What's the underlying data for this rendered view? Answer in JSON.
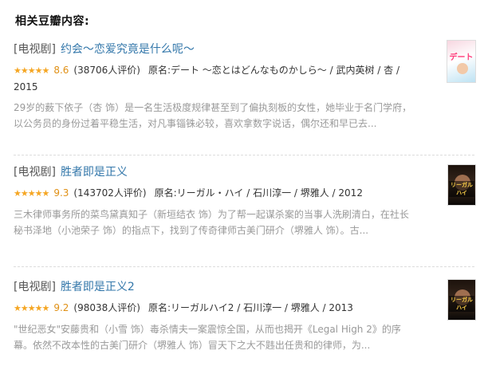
{
  "header": {
    "title": "相关豆瓣内容:"
  },
  "items": [
    {
      "category": "[电视剧]",
      "title": "约会～恋爱究竟是什么呢～",
      "stars": "★★★★★",
      "rating": "8.6",
      "rating_value": 8.6,
      "count": "(38706人评价)",
      "info": "原名:デート 〜恋とはどんなものかしら〜 / 武内英树 / 杏 / 2015",
      "desc": "29岁的薮下依子（杏 饰）是一名生活极度规律甚至到了偏执刻板的女性，她毕业于名门学府，以公务员的身份过着平稳生活，对凡事锱铢必较，喜欢拿数字说话，偶尔还和早已去...",
      "poster": {
        "logo": "デート"
      }
    },
    {
      "category": "[电视剧]",
      "title": "胜者即是正义",
      "stars": "★★★★★",
      "rating": "9.3",
      "rating_value": 9.3,
      "count": "(143702人评价)",
      "info": "原名:リーガル・ハイ / 石川淳一 / 堺雅人 / 2012",
      "desc": "三木律师事务所的菜鸟黛真知子（新垣结衣 饰）为了帮一起谋杀案的当事人洗刷清白，在社长秘书泽地（小池荣子 饰）的指点下，找到了传奇律师古美门研介（堺雅人 饰）。古...",
      "poster": {
        "logo": "リーガルハイ"
      }
    },
    {
      "category": "[电视剧]",
      "title": "胜者即是正义2",
      "stars": "★★★★★",
      "rating": "9.2",
      "rating_value": 9.2,
      "count": "(98038人评价)",
      "info": "原名:リーガルハイ2 / 石川淳一 / 堺雅人 / 2013",
      "desc": "\"世纪恶女\"安藤贵和（小雪 饰）毒杀情夫一案震惊全国，从而也揭开《Legal High 2》的序幕。依然不改本性的古美门研介（堺雅人 饰）冒天下之大不韪出任贵和的律师，为...",
      "poster": {
        "logo": "リーガルハイ"
      }
    }
  ],
  "colors": {
    "link": "#3377aa",
    "rating": "#e09015",
    "stars": "#f5a623",
    "muted": "#999999"
  },
  "icons": [
    "star-rating-icon",
    "poster-image"
  ]
}
